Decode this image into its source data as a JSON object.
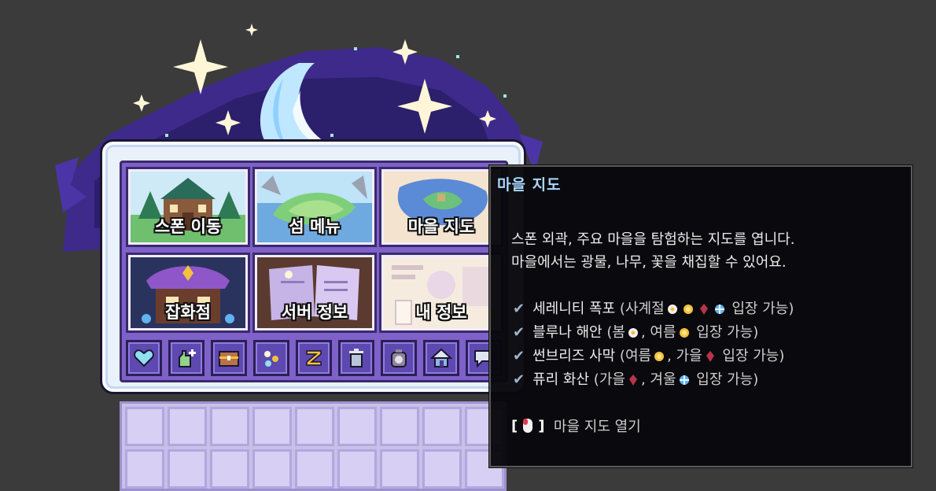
{
  "menu_tiles": [
    {
      "label": "스폰 이동",
      "icon": "town-house-icon"
    },
    {
      "label": "섬 메뉴",
      "icon": "island-icon"
    },
    {
      "label": "마을 지도",
      "icon": "village-map-icon"
    },
    {
      "label": "잡화점",
      "icon": "shop-icon"
    },
    {
      "label": "서버 정보",
      "icon": "book-icon"
    },
    {
      "label": "내 정보",
      "icon": "profile-card-icon"
    }
  ],
  "quick_icons": [
    "heart-icon",
    "hand-plus-icon",
    "chest-icon",
    "dots-icon",
    "sleep-z-icon",
    "trash-icon",
    "backpack-icon",
    "house-icon",
    "chat-icon"
  ],
  "tooltip": {
    "title": "마을 지도",
    "desc_line1": "스폰 외곽, 주요 마을을 탐험하는 지도를 엽니다.",
    "desc_line2": "마을에서는 광물, 나무, 꽃을 채집할 수 있어요.",
    "locations": [
      {
        "name": "세레니티 폭포",
        "open_pre": "(사계절",
        "open_post": "입장 가능)"
      },
      {
        "name": "블루나 해안",
        "season1": "(봄",
        "season2": "여름",
        "open_post": "입장 가능)"
      },
      {
        "name": "썬브리즈 사막",
        "season1": "(여름",
        "season2": "가을",
        "open_post": "입장 가능)"
      },
      {
        "name": "퓨리 화산",
        "season1": "(가을",
        "season2": "겨울",
        "open_post": "입장 가능)"
      }
    ],
    "footer_action": "마을 지도 열기",
    "bracket_open": "[",
    "bracket_close": "]"
  },
  "colors": {
    "spring": "#f5f0f5",
    "summer": "#f3c23c",
    "autumn": "#b8344a",
    "winter": "#5fb4f0",
    "title": "#a9d8ff"
  }
}
